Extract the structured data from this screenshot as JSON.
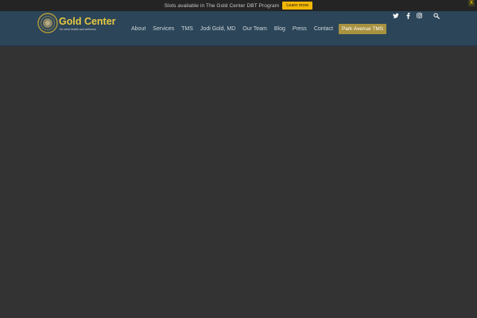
{
  "announcement": {
    "message": "Slots available in The Gold Center DBT Program",
    "button_label": "Learn more",
    "close_label": "X"
  },
  "brand": {
    "name": "Gold Center",
    "tagline": "for mind health and wellness"
  },
  "nav": {
    "items": [
      {
        "label": "About"
      },
      {
        "label": "Services"
      },
      {
        "label": "TMS"
      },
      {
        "label": "Jodi Gold, MD"
      },
      {
        "label": "Our Team"
      },
      {
        "label": "Blog"
      },
      {
        "label": "Press"
      },
      {
        "label": "Contact"
      }
    ],
    "cta_label": "Park Avenue TMS"
  },
  "icons": [
    "twitter-icon",
    "facebook-icon",
    "instagram-icon",
    "search-icon"
  ],
  "colors": {
    "header_bg": "#2c4558",
    "page_bg": "#333333",
    "accent_gold": "#e8c840",
    "announce_button": "#f2b705",
    "cta_bg": "#a89240"
  }
}
